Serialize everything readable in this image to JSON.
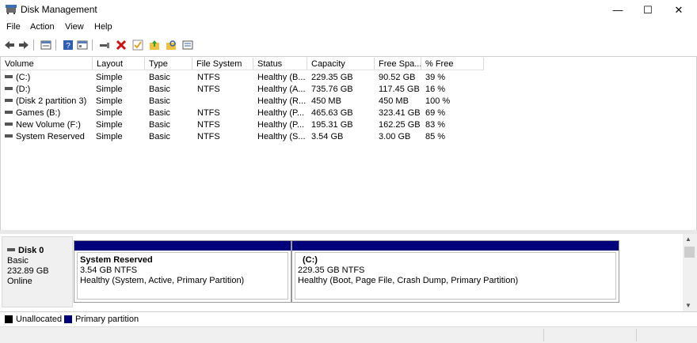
{
  "window": {
    "title": "Disk Management",
    "minimize": "—",
    "maximize": "☐",
    "close": "✕"
  },
  "menu": [
    "File",
    "Action",
    "View",
    "Help"
  ],
  "toolbar": {
    "icons": [
      "back-icon",
      "forward-icon",
      "properties-icon",
      "help-icon",
      "console-tree-icon",
      "connect-icon",
      "delete-icon",
      "check-icon",
      "folder-up-icon",
      "folder-search-icon",
      "settings-list-icon"
    ]
  },
  "columns": [
    "Volume",
    "Layout",
    "Type",
    "File System",
    "Status",
    "Capacity",
    "Free Spa...",
    "% Free"
  ],
  "volumes": [
    {
      "volume": "(C:)",
      "layout": "Simple",
      "type": "Basic",
      "fs": "NTFS",
      "status": "Healthy (B...",
      "capacity": "229.35 GB",
      "free": "90.52 GB",
      "pct": "39 %"
    },
    {
      "volume": "(D:)",
      "layout": "Simple",
      "type": "Basic",
      "fs": "NTFS",
      "status": "Healthy (A...",
      "capacity": "735.76 GB",
      "free": "117.45 GB",
      "pct": "16 %"
    },
    {
      "volume": "(Disk 2 partition 3)",
      "layout": "Simple",
      "type": "Basic",
      "fs": "",
      "status": "Healthy (R...",
      "capacity": "450 MB",
      "free": "450 MB",
      "pct": "100 %"
    },
    {
      "volume": "Games (B:)",
      "layout": "Simple",
      "type": "Basic",
      "fs": "NTFS",
      "status": "Healthy (P...",
      "capacity": "465.63 GB",
      "free": "323.41 GB",
      "pct": "69 %"
    },
    {
      "volume": "New Volume (F:)",
      "layout": "Simple",
      "type": "Basic",
      "fs": "NTFS",
      "status": "Healthy (P...",
      "capacity": "195.31 GB",
      "free": "162.25 GB",
      "pct": "83 %"
    },
    {
      "volume": "System Reserved",
      "layout": "Simple",
      "type": "Basic",
      "fs": "NTFS",
      "status": "Healthy (S...",
      "capacity": "3.54 GB",
      "free": "3.00 GB",
      "pct": "85 %"
    }
  ],
  "disk": {
    "name": "Disk 0",
    "type": "Basic",
    "size": "232.89 GB",
    "state": "Online",
    "partitions": [
      {
        "name": "System Reserved",
        "size": "3.54 GB NTFS",
        "status": "Healthy (System, Active, Primary Partition)"
      },
      {
        "name": "(C:)",
        "size": "229.35 GB NTFS",
        "status": "Healthy (Boot, Page File, Crash Dump, Primary Partition)"
      }
    ]
  },
  "legend": [
    {
      "label": "Unallocated",
      "color": "#000000"
    },
    {
      "label": "Primary partition",
      "color": "#00007a"
    }
  ],
  "scroll": {
    "up": "▲",
    "down": "▼"
  }
}
